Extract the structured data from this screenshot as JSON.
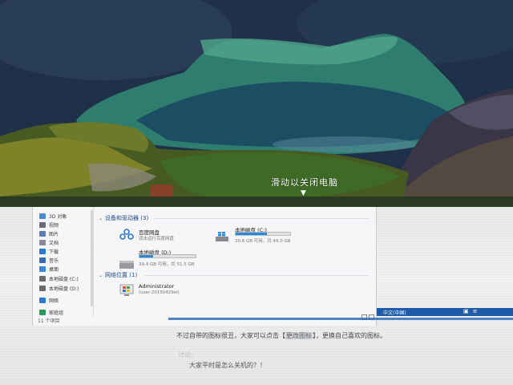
{
  "lock_screen": {
    "hint_text": "滑动以关闭电脑",
    "arrow_glyph": "▼"
  },
  "explorer": {
    "nav": {
      "items": [
        {
          "label": "3D 对象",
          "icon": "cube-icon",
          "color": "#4a8ad8"
        },
        {
          "label": "视频",
          "icon": "video-icon",
          "color": "#6a6a7a"
        },
        {
          "label": "图片",
          "icon": "picture-icon",
          "color": "#5a7ab8"
        },
        {
          "label": "文档",
          "icon": "document-icon",
          "color": "#8a8a9a"
        },
        {
          "label": "下载",
          "icon": "download-icon",
          "color": "#2a78d0"
        },
        {
          "label": "音乐",
          "icon": "music-icon",
          "color": "#3a6ab0"
        },
        {
          "label": "桌面",
          "icon": "desktop-icon",
          "color": "#3a88d8"
        },
        {
          "label": "本地磁盘 (C:)",
          "icon": "drive-icon",
          "color": "#6a6a6a"
        },
        {
          "label": "本地磁盘 (D:)",
          "icon": "drive-icon",
          "color": "#6a6a6a"
        },
        {
          "label": "网络",
          "icon": "network-icon",
          "color": "#2a78d0"
        },
        {
          "label": "家庭组",
          "icon": "homegroup-icon",
          "color": "#2a9a5a"
        }
      ]
    },
    "status": "11 个项目",
    "devices_section": {
      "label": "设备和驱动器 (3)"
    },
    "tiles": [
      {
        "name": "百度网盘",
        "sub": "双击运行百度网盘",
        "icon": "baidu-netdisk-icon"
      },
      {
        "name": "本地磁盘 (C:)",
        "sub": "20.6 GB 可用，共 49.0 GB",
        "progress": 0.58,
        "icon": "windows-drive-icon"
      },
      {
        "name": "本地磁盘 (D:)",
        "sub": "39.4 GB 可用，共 51.5 GB",
        "progress": 0.24,
        "icon": "drive-icon"
      }
    ],
    "network_section": {
      "label": "网络位置 (1)"
    },
    "network_item": {
      "name": "Administrator",
      "sub": "(user-20150429ei)",
      "icon": "windows-computer-icon"
    }
  },
  "taskbar": {
    "ime_text": "中文(中国)"
  },
  "document": {
    "line1_before": "不过自带的图标很丑，大家可以点击【",
    "line1_highlight": "更改图标",
    "line1_after": "】，更换自己喜欢的图标。",
    "label": "讨论：",
    "question": "大家平时是怎么关机的？！"
  },
  "colors": {
    "accent": "#2a8ad8",
    "taskbar": "#1e5aa8"
  }
}
